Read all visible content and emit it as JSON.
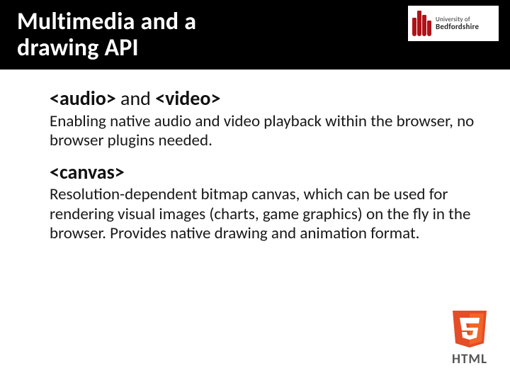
{
  "header": {
    "title_line1": "Multimedia and a",
    "title_line2": "drawing API",
    "logo": {
      "text_top": "University of",
      "text_bottom": "Bedfordshire"
    }
  },
  "sections": [
    {
      "heading_parts": {
        "b1": "<audio>",
        "mid": " and ",
        "b2": "<video>"
      },
      "body": "Enabling native audio and video playback within the browser, no browser plugins needed."
    },
    {
      "heading_parts": {
        "b1": "<canvas>",
        "mid": "",
        "b2": ""
      },
      "body": "Resolution-dependent bitmap canvas, which can be used for rendering visual images (charts, game graphics) on the fly in the browser. Provides native drawing and animation format."
    }
  ],
  "footer": {
    "html_label": "HTML",
    "version": "5"
  },
  "colors": {
    "header_bg": "#000000",
    "accent_red": "#b01218",
    "html5_orange": "#e44d26",
    "html5_orange_light": "#f16529"
  }
}
